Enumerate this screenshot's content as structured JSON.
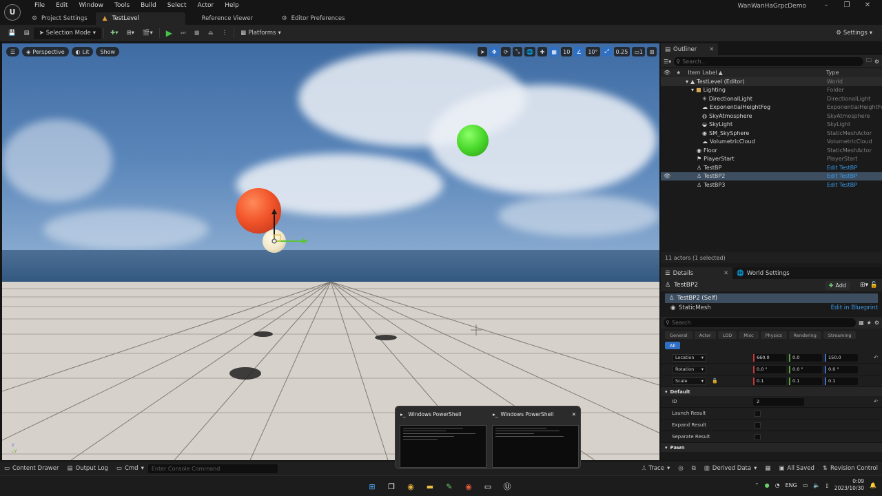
{
  "menu": [
    "File",
    "Edit",
    "Window",
    "Tools",
    "Build",
    "Select",
    "Actor",
    "Help"
  ],
  "project_name": "WanWanHaGrpcDemo",
  "doc_tabs": [
    {
      "label": "Project Settings"
    },
    {
      "label": "TestLevel"
    },
    {
      "label": "Reference Viewer"
    },
    {
      "label": "Editor Preferences"
    }
  ],
  "toolbar": {
    "selection_mode": "Selection Mode",
    "platforms": "Platforms",
    "settings": "Settings"
  },
  "viewport": {
    "perspective": "Perspective",
    "lit": "Lit",
    "show": "Show",
    "grid_snap": "10",
    "rot_snap": "10°",
    "scale_snap": "0.25",
    "cam_speed": "1"
  },
  "outliner": {
    "tab": "Outliner",
    "search_placeholder": "Search...",
    "col_label": "Item Label",
    "col_type": "Type",
    "rows": [
      {
        "name": "TestLevel (Editor)",
        "type": "World",
        "indent": 0
      },
      {
        "name": "Lighting",
        "type": "Folder",
        "indent": 1
      },
      {
        "name": "DirectionalLight",
        "type": "DirectionalLight",
        "indent": 2
      },
      {
        "name": "ExponentialHeightFog",
        "type": "ExponentialHeightFog",
        "indent": 2
      },
      {
        "name": "SkyAtmosphere",
        "type": "SkyAtmosphere",
        "indent": 2
      },
      {
        "name": "SkyLight",
        "type": "SkyLight",
        "indent": 2
      },
      {
        "name": "SM_SkySphere",
        "type": "StaticMeshActor",
        "indent": 2
      },
      {
        "name": "VolumetricCloud",
        "type": "VolumetricCloud",
        "indent": 2
      },
      {
        "name": "Floor",
        "type": "StaticMeshActor",
        "indent": 1
      },
      {
        "name": "PlayerStart",
        "type": "PlayerStart",
        "indent": 1
      },
      {
        "name": "TestBP",
        "type": "Edit TestBP",
        "indent": 1
      },
      {
        "name": "TestBP2",
        "type": "Edit TestBP",
        "indent": 1
      },
      {
        "name": "TestBP3",
        "type": "Edit TestBP",
        "indent": 1
      }
    ],
    "footer": "11 actors (1 selected)"
  },
  "details": {
    "tab": "Details",
    "world_settings_tab": "World Settings",
    "actor_name": "TestBP2",
    "add_label": "Add",
    "self_component": "TestBP2 (Self)",
    "static_mesh": "StaticMesh",
    "edit_blueprint": "Edit in Blueprint",
    "search_placeholder": "Search",
    "filters": [
      "General",
      "Actor",
      "LOD",
      "Misc",
      "Physics",
      "Rendering",
      "Streaming",
      "All"
    ],
    "location_label": "Location",
    "location": [
      "660.0",
      "0.0",
      "150.0"
    ],
    "rotation_label": "Rotation",
    "rotation": [
      "0.0 °",
      "0.0 °",
      "0.0 °"
    ],
    "scale_label": "Scale",
    "scale": [
      "0.1",
      "0.1",
      "0.1"
    ],
    "section_default": "Default",
    "id_label": "ID",
    "id_value": "2",
    "launch_result": "Launch Result",
    "expand_result": "Expand Result",
    "separate_result": "Separate Result",
    "section_pawn": "Pawn"
  },
  "statusbar": {
    "content_drawer": "Content Drawer",
    "output_log": "Output Log",
    "cmd": "Cmd",
    "console_placeholder": "Enter Console Command",
    "trace": "Trace",
    "derived_data": "Derived Data",
    "all_saved": "All Saved",
    "revision_control": "Revision Control"
  },
  "powershell": {
    "title1": "Windows PowerShell",
    "title2": "Windows PowerShell"
  },
  "taskbar": {
    "lang": "ENG",
    "time": "0:09",
    "date": "2023/10/30"
  },
  "colors": {
    "selection": "#3d4e60",
    "accent": "#2f6fc4",
    "link": "#3b9be8",
    "play_green": "#47c447"
  }
}
